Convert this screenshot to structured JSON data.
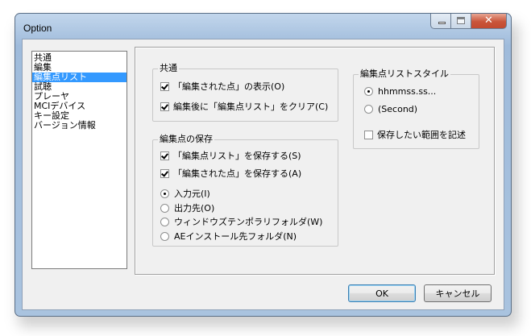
{
  "window": {
    "title": "Option"
  },
  "sidebar": {
    "items": [
      {
        "label": "共通"
      },
      {
        "label": "編集"
      },
      {
        "label": "編集点リスト",
        "selected": true
      },
      {
        "label": "試聴"
      },
      {
        "label": "プレーヤ"
      },
      {
        "label": "MCIデバイス"
      },
      {
        "label": "キー設定"
      },
      {
        "label": "バージョン情報"
      }
    ]
  },
  "common_group": {
    "title": "共通",
    "show_edited_points": {
      "label": "「編集された点」の表示(O)",
      "checked": true
    },
    "clear_after_edit": {
      "label": "編集後に「編集点リスト」をクリア(C)",
      "checked": true
    }
  },
  "save_group": {
    "title": "編集点の保存",
    "save_list": {
      "label": "「編集点リスト」を保存する(S)",
      "checked": true
    },
    "save_points": {
      "label": "「編集された点」を保存する(A)",
      "checked": true
    },
    "destinations": [
      {
        "label": "入力元(I)",
        "selected": true
      },
      {
        "label": "出力先(O)",
        "selected": false
      },
      {
        "label": "ウィンドウズテンポラリフォルダ(W)",
        "selected": false
      },
      {
        "label": "AEインストール先フォルダ(N)",
        "selected": false
      }
    ]
  },
  "style_group": {
    "title": "編集点リストスタイル",
    "formats": [
      {
        "label": "hhmmss.ss...",
        "selected": true
      },
      {
        "label": "(Second)",
        "selected": false
      }
    ],
    "record_range": {
      "label": "保存したい範囲を記述",
      "checked": false
    }
  },
  "buttons": {
    "ok": "OK",
    "cancel": "キャンセル"
  }
}
